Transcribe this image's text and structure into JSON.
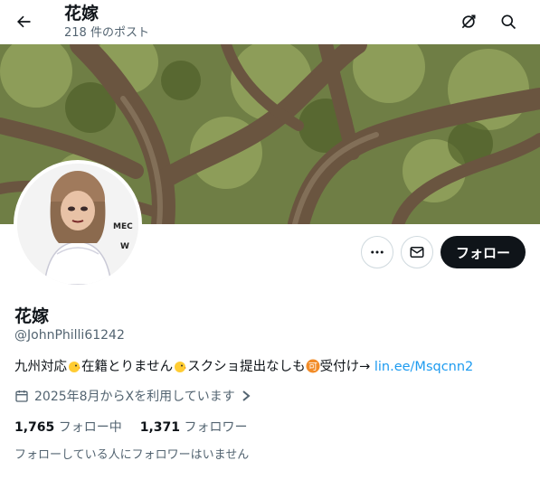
{
  "header": {
    "title": "花嫁",
    "post_count": "218 件のポスト",
    "icons": [
      "back-arrow-icon",
      "no-notify-icon",
      "search-icon"
    ]
  },
  "profile": {
    "name": "花嫁",
    "handle": "@JohnPhilli61242",
    "bio_segments": {
      "part1": "九州対応",
      "part2": "在籍とりません",
      "part3": "スクショ提出なしも",
      "part4": "受付け→ ",
      "link": "lin.ee/Msqcnn2"
    },
    "joined": "2025年8月からXを利用しています",
    "following_count": "1,765",
    "following_label": "フォロー中",
    "followers_count": "1,371",
    "followers_label": "フォロワー",
    "followers_note": "フォローしている人にフォロワーはいません"
  },
  "actions": {
    "follow_label": "フォロー",
    "icons": [
      "more-icon",
      "message-icon"
    ]
  },
  "colors": {
    "accent": "#1d9bf0",
    "follow_bg": "#0f1419",
    "muted_text": "#536471"
  }
}
